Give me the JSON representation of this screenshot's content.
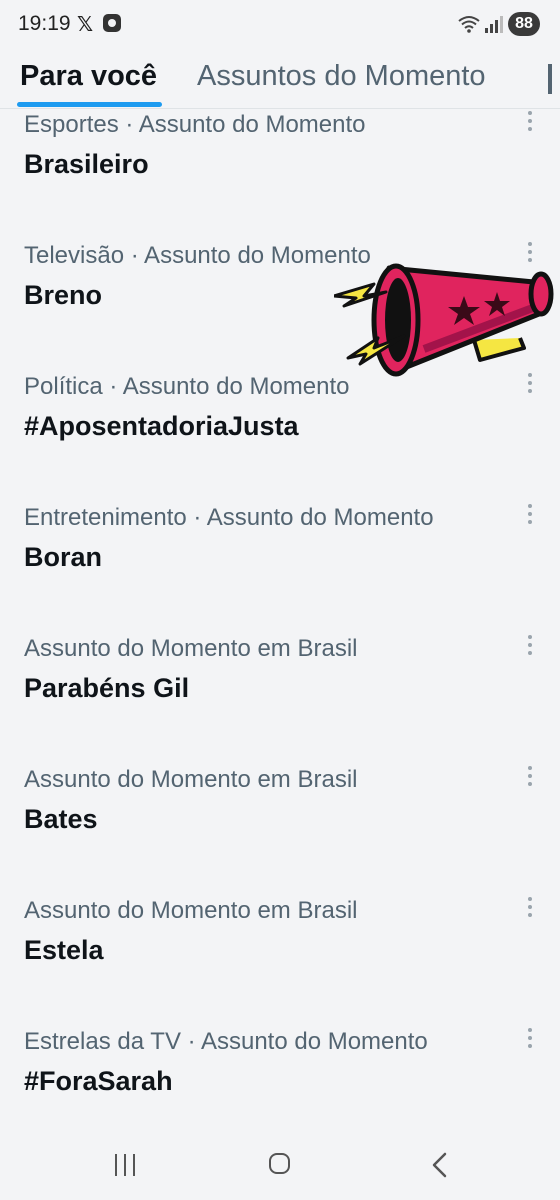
{
  "status_bar": {
    "time": "19:19",
    "x_glyph": "𝕏",
    "battery": "88",
    "icons": [
      "x-logo-icon",
      "notification-app-icon",
      "wifi-icon",
      "signal-icon",
      "battery-icon"
    ]
  },
  "tabs": [
    {
      "label": "Para você",
      "active": true
    },
    {
      "label": "Assuntos do Momento",
      "active": false
    }
  ],
  "trends": [
    {
      "meta": "Esportes · Assunto do Momento",
      "title": "Brasileiro"
    },
    {
      "meta": "Televisão · Assunto do Momento",
      "title": "Breno"
    },
    {
      "meta": "Política · Assunto do Momento",
      "title": "#AposentadoriaJusta"
    },
    {
      "meta": "Entretenimento · Assunto do Momento",
      "title": "Boran"
    },
    {
      "meta": "Assunto do Momento em Brasil",
      "title": "Parabéns Gil"
    },
    {
      "meta": "Assunto do Momento em Brasil",
      "title": "Bates"
    },
    {
      "meta": "Assunto do Momento em Brasil",
      "title": "Estela"
    },
    {
      "meta": "Estrelas da TV · Assunto do Momento",
      "title": "#ForaSarah"
    }
  ],
  "colors": {
    "accent": "#1d9bf0",
    "text_primary": "#0f1419",
    "text_secondary": "#536471",
    "megaphone_body": "#e0245e",
    "megaphone_bolt": "#f5e642"
  },
  "overlay_icon": "megaphone-icon",
  "nav_bar": {
    "icons": [
      "recents-icon",
      "home-icon",
      "back-icon"
    ]
  }
}
